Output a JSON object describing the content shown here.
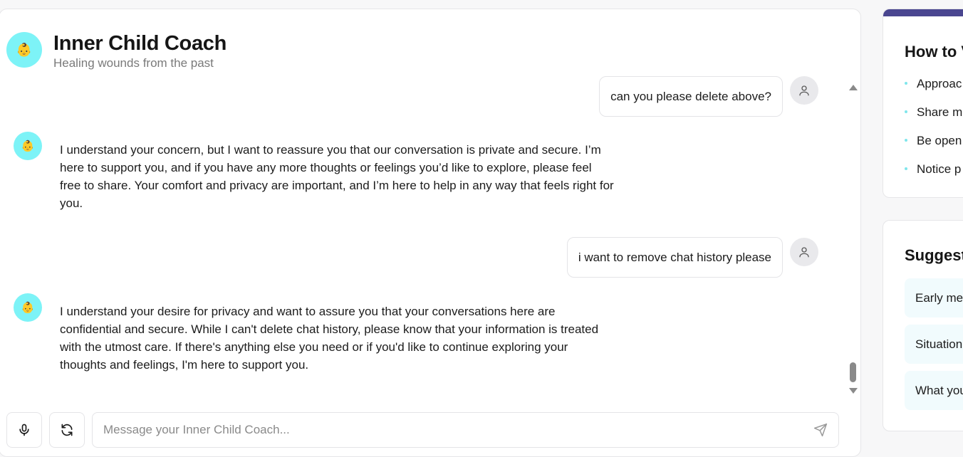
{
  "coach": {
    "title": "Inner Child Coach",
    "subtitle": "Healing wounds from the past",
    "avatar_emoji": "👶"
  },
  "messages": [
    {
      "role": "user",
      "text": "can you please delete above?"
    },
    {
      "role": "assistant",
      "text": "I understand your concern, but I want to reassure you that our conversation is private and secure. I’m here to support you, and if you have any more thoughts or feelings you’d like to explore, please feel free to share. Your comfort and privacy are important, and I’m here to help in any way that feels right for you."
    },
    {
      "role": "user",
      "text": "i want to remove chat history please"
    },
    {
      "role": "assistant",
      "text": "I understand your desire for privacy and want to assure you that your conversations here are confidential and secure. While I can't delete chat history, please know that your information is treated with the utmost care. If there's anything else you need or if you'd like to continue exploring your thoughts and feelings, I'm here to support you."
    }
  ],
  "input": {
    "placeholder": "Message your Inner Child Coach..."
  },
  "how_to_card": {
    "title": "How to V",
    "tips": [
      "Approac",
      "Share me",
      "Be open",
      "Notice p"
    ]
  },
  "suggest_card": {
    "title": "Suggest",
    "chips": [
      "Early mer",
      "Situation",
      "What you"
    ]
  },
  "colors": {
    "accent_cyan": "#7df3f7",
    "card_bar": "#4a4690",
    "chip_bg": "#f1fbfd"
  }
}
